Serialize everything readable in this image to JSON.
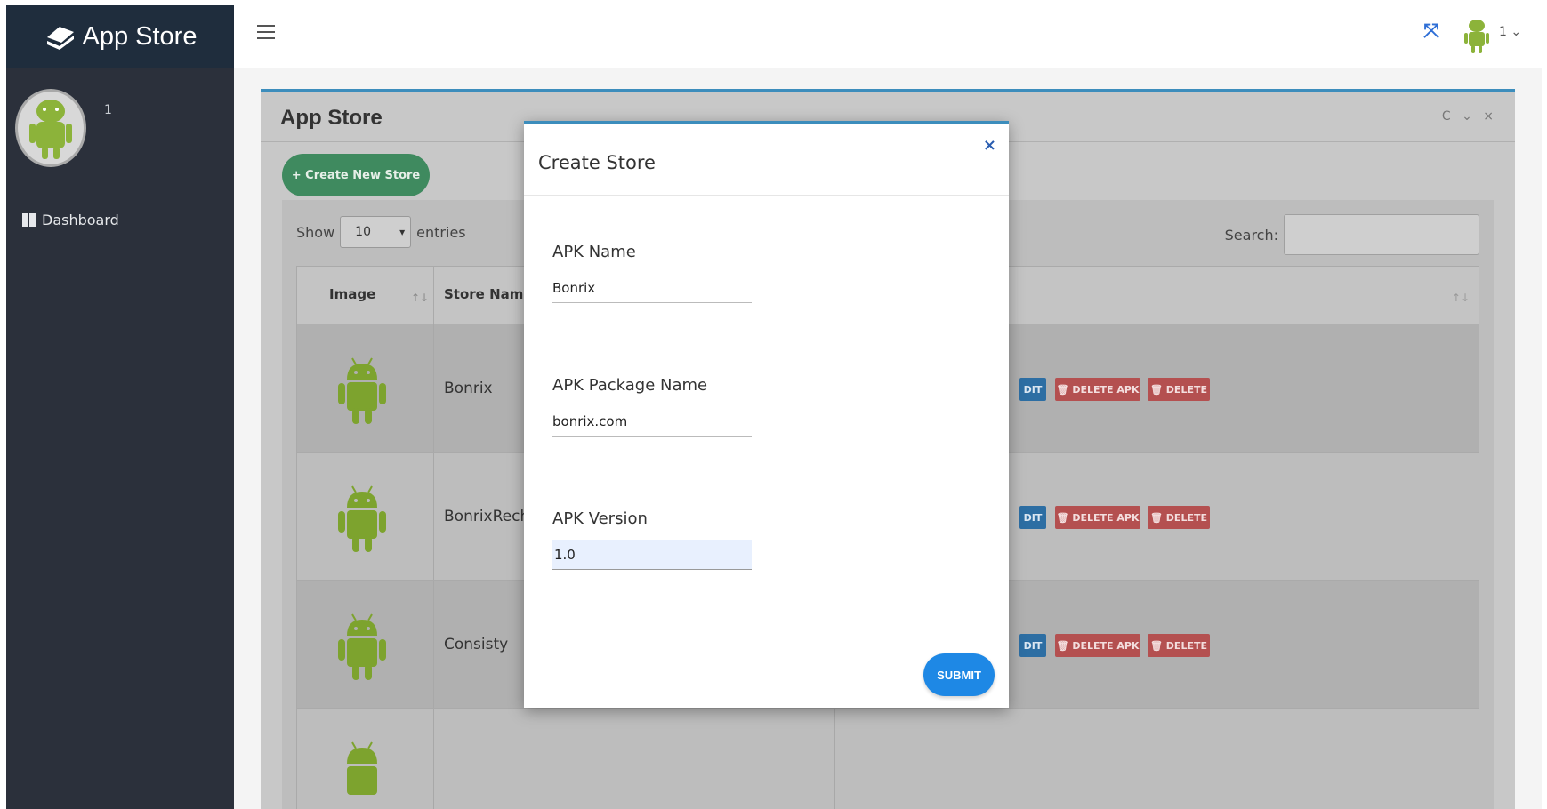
{
  "brand": {
    "name": "App Store",
    "icon": "app-store-logo-icon"
  },
  "sidebar": {
    "user_name": "1",
    "items": [
      {
        "label": "Dashboard",
        "icon": "dashboard-icon"
      }
    ]
  },
  "header": {
    "user_name": "1",
    "menu_icon": "hamburger-icon",
    "fullscreen_icon": "fullscreen-icon"
  },
  "card": {
    "title": "App Store",
    "tools": "C ⌄ ×",
    "create_button": "+ Create New Store"
  },
  "table": {
    "show_label": "Show",
    "page_size": "10",
    "entries_label": "entries",
    "search_label": "Search:",
    "columns": [
      "Image",
      "Store Name"
    ],
    "sort_icon": "↑↓",
    "rows": [
      {
        "name": "Bonrix",
        "edit_label": "DIT",
        "delete_apk_label": "🗑 DELETE APK",
        "delete_label": "🗑 DELETE"
      },
      {
        "name": "BonrixRech",
        "edit_label": "DIT",
        "delete_apk_label": "🗑 DELETE APK",
        "delete_label": "🗑 DELETE"
      },
      {
        "name": "Consisty",
        "edit_label": "DIT",
        "delete_apk_label": "🗑 DELETE APK",
        "delete_label": "🗑 DELETE"
      }
    ]
  },
  "modal": {
    "title": "Create Store",
    "close": "×",
    "fields": [
      {
        "label": "APK Name",
        "value": "Bonrix"
      },
      {
        "label": "APK Package Name",
        "value": "bonrix.com"
      },
      {
        "label": "APK Version",
        "value": "1.0"
      }
    ],
    "submit_label": "SUBMIT"
  },
  "colors": {
    "sidebar_bg": "#2b303b",
    "brand_bg": "#1f2d3d",
    "accent": "#3c8dbc",
    "create_btn": "#3f8a5f",
    "submit_btn": "#1e88e5",
    "danger": "#b45050",
    "android_green": "#8cb33a"
  }
}
